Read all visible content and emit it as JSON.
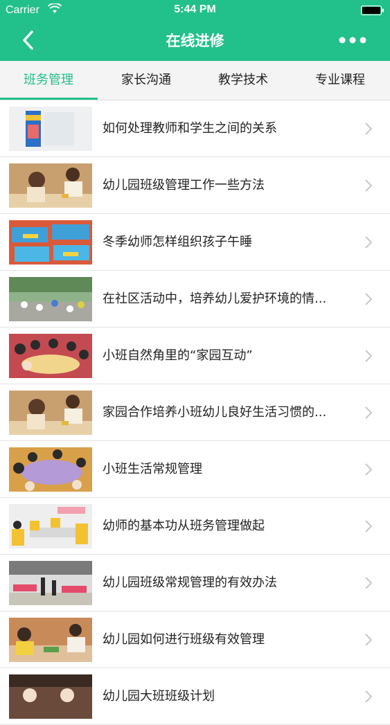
{
  "status_bar": {
    "carrier": "Carrier",
    "time": "5:44 PM",
    "wifi_icon": "wifi-icon",
    "battery_icon": "battery-icon"
  },
  "nav_bar": {
    "title": "在线进修",
    "back_icon": "chevron-left-icon",
    "more_icon": "more-dots-icon",
    "background_color": "#22c08a"
  },
  "tabs": [
    {
      "label": "班务管理",
      "active": true
    },
    {
      "label": "家长沟通",
      "active": false
    },
    {
      "label": "教学技术",
      "active": false
    },
    {
      "label": "专业课程",
      "active": false
    }
  ],
  "articles": [
    {
      "title": "如何处理教师和学生之间的关系"
    },
    {
      "title": "幼儿园班级管理工作一些方法"
    },
    {
      "title": "冬季幼师怎样组织孩子午睡"
    },
    {
      "title": "在社区活动中，培养幼儿爱护环境的情..."
    },
    {
      "title": "小班自然角里的“家园互动”"
    },
    {
      "title": "家园合作培养小班幼儿良好生活习惯的..."
    },
    {
      "title": "小班生活常规管理"
    },
    {
      "title": "幼师的基本功从班务管理做起"
    },
    {
      "title": "幼儿园班级常规管理的有效办法"
    },
    {
      "title": "幼儿园如何进行班级有效管理"
    },
    {
      "title": "幼儿园大班班级计划"
    }
  ]
}
